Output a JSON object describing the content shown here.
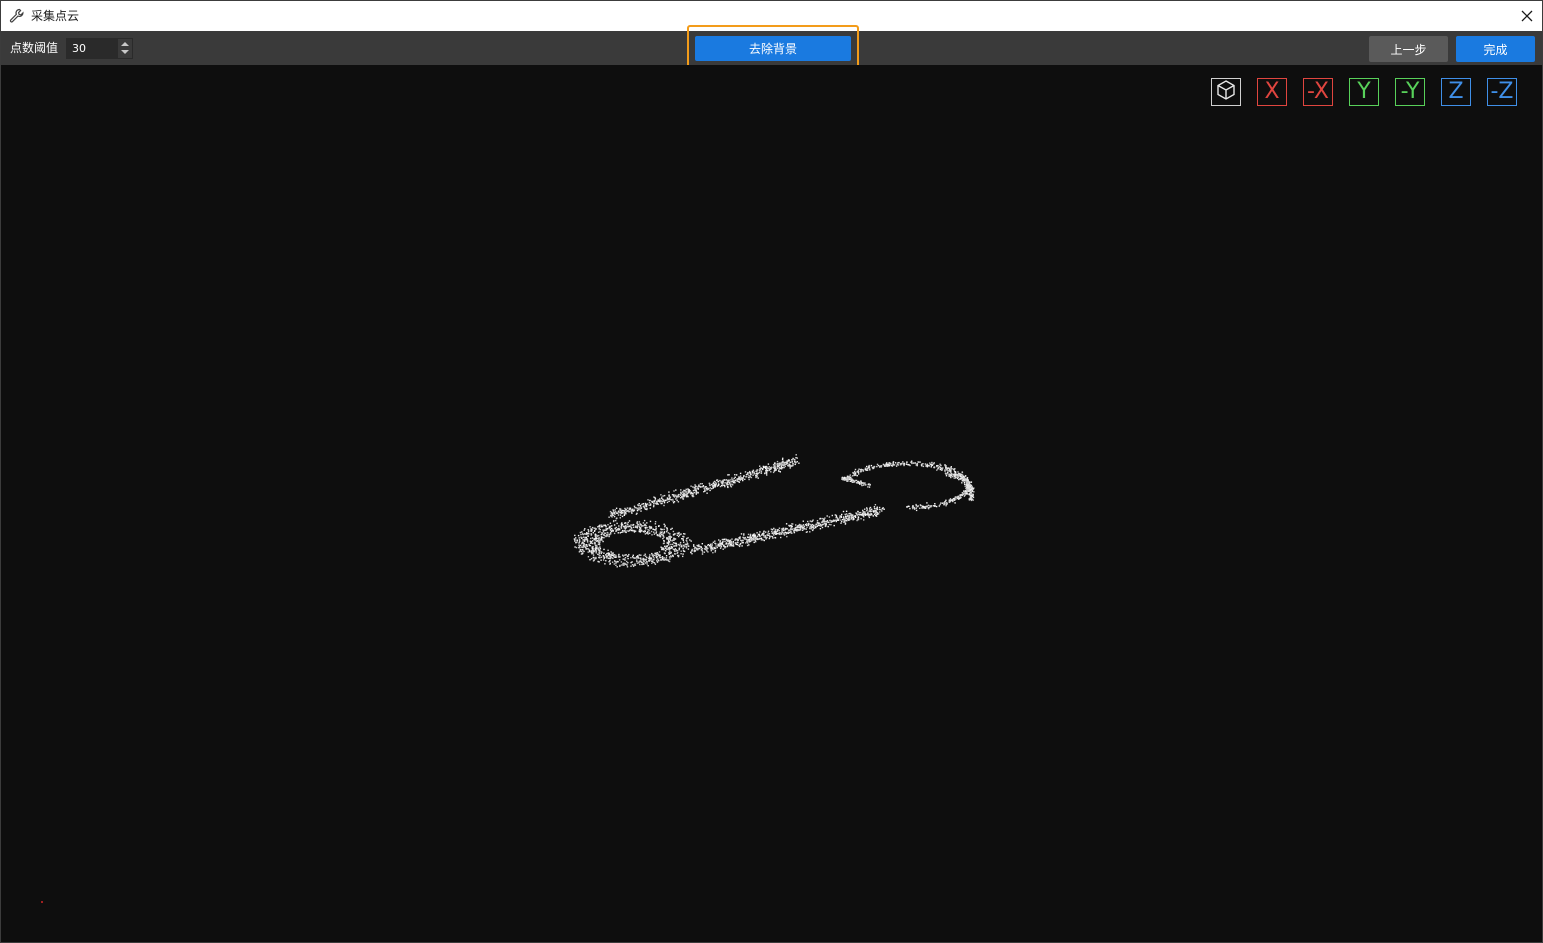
{
  "window": {
    "title": "采集点云",
    "title_icon": "wrench-icon",
    "close_icon": "close-icon"
  },
  "toolbar": {
    "threshold_label": "点数阈值",
    "threshold_value": "30",
    "remove_background_label": "去除背景",
    "previous_step_label": "上一步",
    "finish_label": "完成"
  },
  "view_controls": {
    "iso_icon": "cube-icon",
    "x": "X",
    "neg_x": "-X",
    "y": "Y",
    "neg_y": "-Y",
    "z": "Z",
    "neg_z": "-Z"
  },
  "colors": {
    "accent_blue": "#1a7ae0",
    "highlight_orange": "#f39c1a",
    "axis_x": "#e0453f",
    "axis_y": "#58d15a",
    "axis_z": "#3f8fe8",
    "viewport_bg": "#0e0e0e",
    "toolbar_bg": "#3a3a3a"
  },
  "viewport": {
    "content": "point-cloud-safety-pin"
  }
}
